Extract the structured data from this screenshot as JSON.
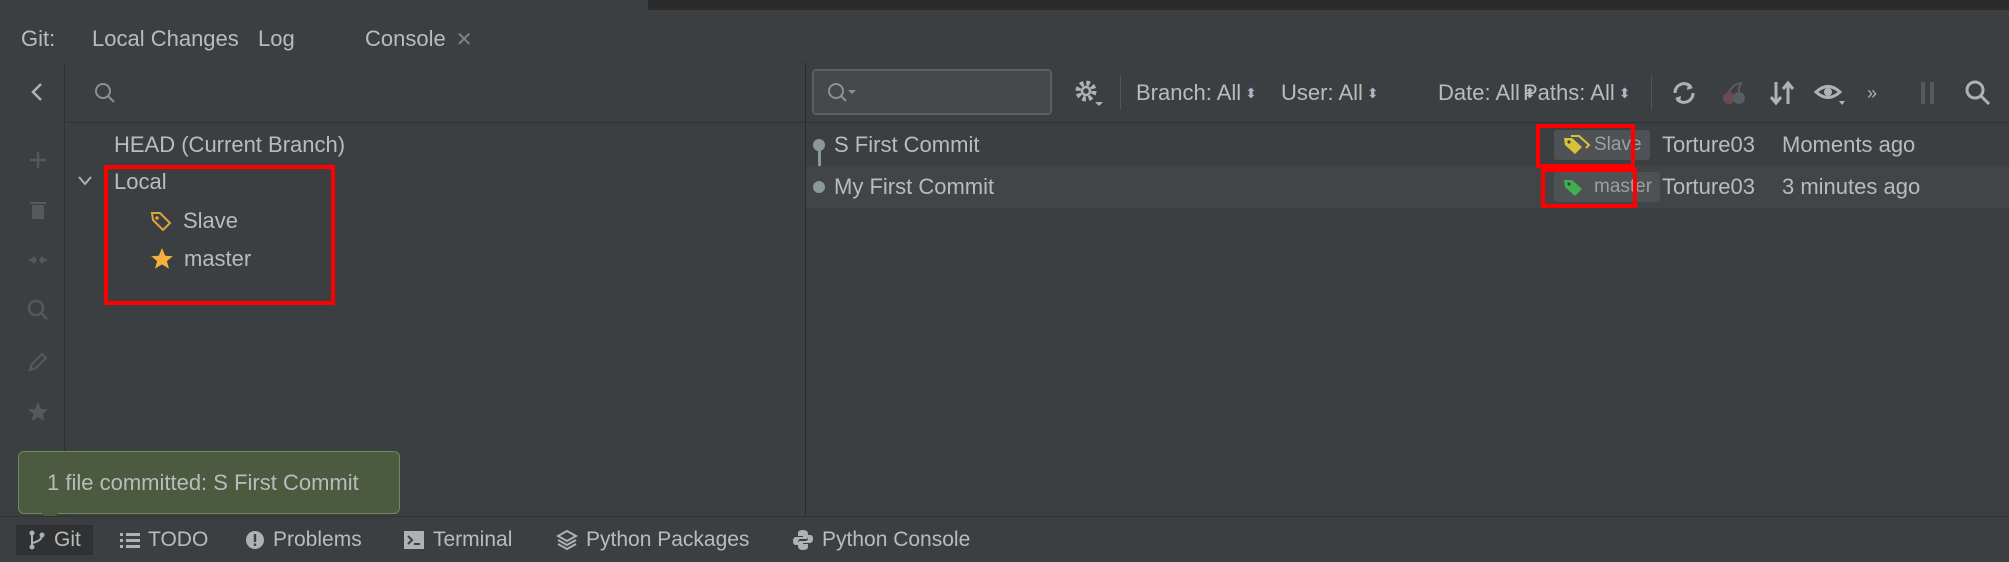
{
  "tabbar": {
    "prefix": "Git:",
    "tabs": [
      {
        "label": "Local Changes"
      },
      {
        "label": "Log",
        "active": true
      },
      {
        "label": "Console",
        "closable": true
      }
    ]
  },
  "left_tools": [
    "back-icon",
    "add-icon",
    "delete-icon",
    "merge-icon",
    "search-icon",
    "edit-icon",
    "star-icon"
  ],
  "branches": {
    "search_placeholder": "",
    "head": "HEAD (Current Branch)",
    "local_group": "Local",
    "items": [
      {
        "label": "Slave",
        "icon": "tag-icon"
      },
      {
        "label": "master",
        "icon": "star-icon"
      }
    ]
  },
  "log_toolbar": {
    "search_placeholder": "",
    "filters": [
      {
        "label": "Branch: All"
      },
      {
        "label": "User: All"
      },
      {
        "label": "Date: All"
      },
      {
        "label": "Paths: All"
      }
    ],
    "icons": [
      "refresh-icon",
      "cherry-pick-icon",
      "sort-icon",
      "eye-icon",
      "more-icon",
      "pause-icon",
      "search-icon"
    ]
  },
  "commits": [
    {
      "message": "S First Commit",
      "ref": "Slave",
      "ref_color": "#d9c13a",
      "author": "Torture03",
      "date": "Moments ago"
    },
    {
      "message": "My First Commit",
      "ref": "master",
      "ref_color": "#3fb04d",
      "author": "Torture03",
      "date": "3 minutes ago"
    }
  ],
  "notification": {
    "text": "1 file committed: S First Commit"
  },
  "bottom_tabs": [
    {
      "label": "Git",
      "icon": "git-branch-icon"
    },
    {
      "label": "TODO",
      "icon": "list-icon"
    },
    {
      "label": "Problems",
      "icon": "problems-icon"
    },
    {
      "label": "Terminal",
      "icon": "terminal-icon"
    },
    {
      "label": "Python Packages",
      "icon": "layers-icon"
    },
    {
      "label": "Python Console",
      "icon": "python-icon"
    }
  ],
  "colors": {
    "background": "#3c3f41",
    "highlight": "#ff0000",
    "notification_bg": "#4c5a40"
  }
}
